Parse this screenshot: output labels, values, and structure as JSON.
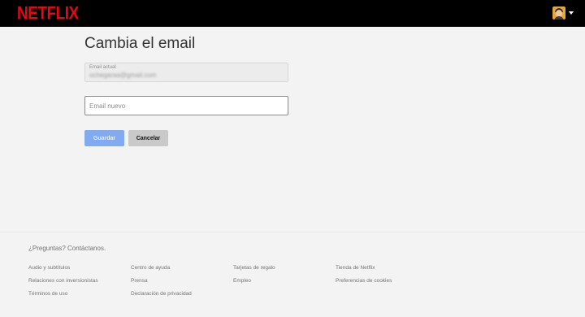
{
  "header": {
    "logo": "NETFLIX",
    "profile_icon": "avatar-icon",
    "menu_icon": "caret-down-icon",
    "brand_color": "#e50914"
  },
  "main": {
    "title": "Cambia el email",
    "current_email": {
      "label": "Email actual",
      "value": "ochegaraa@gmail.com"
    },
    "new_email": {
      "placeholder": "Email nuevo",
      "value": ""
    },
    "buttons": {
      "save": "Guardar",
      "cancel": "Cancelar"
    }
  },
  "footer": {
    "question": "¿Preguntas? Contáctanos.",
    "links": [
      "Audio y subtítulos",
      "Relaciones con inversionistas",
      "Términos de uso",
      "Centro de ayuda",
      "Prensa",
      "Declaración de privacidad",
      "Tarjetas de regalo",
      "Empleo",
      "Tienda de Netflix",
      "Preferencias de cookies"
    ]
  }
}
